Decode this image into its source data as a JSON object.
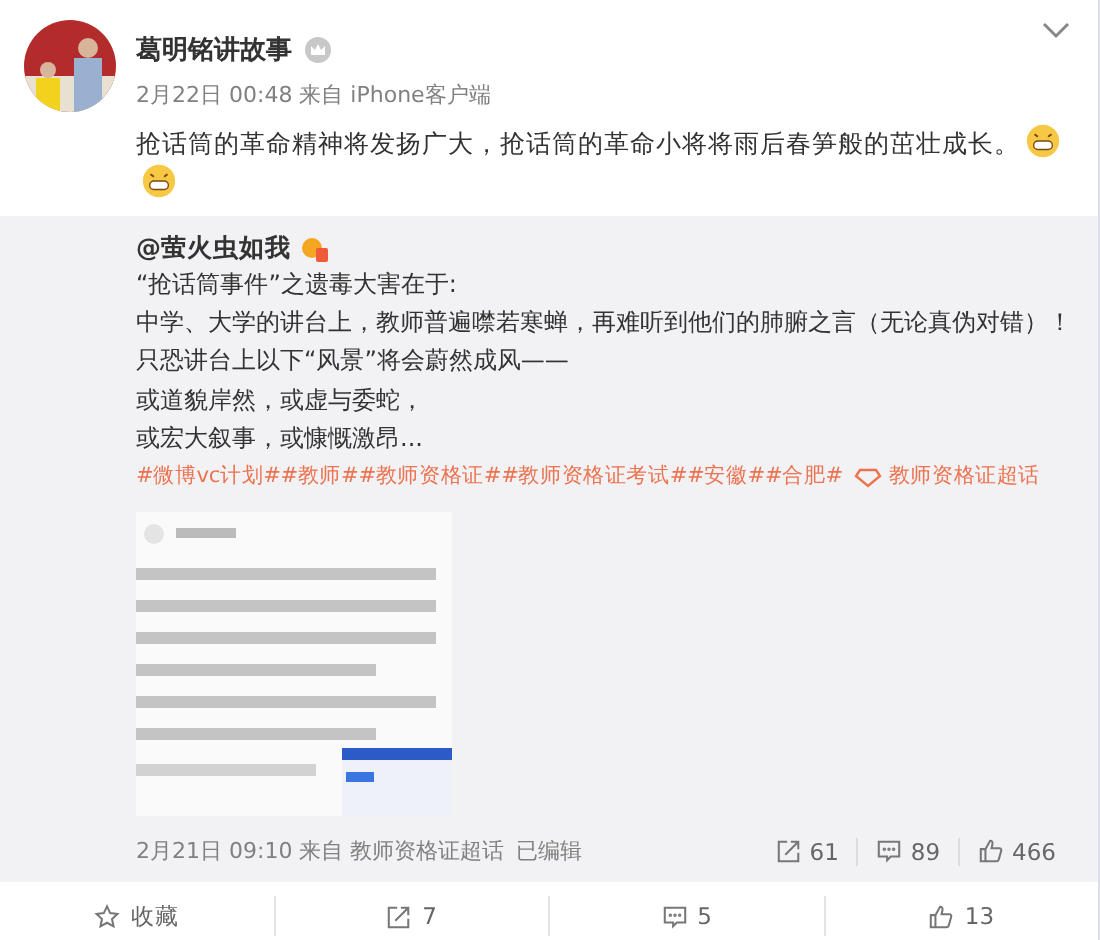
{
  "author": {
    "name": "葛明铭讲故事",
    "meta": "2月22日 00:48 来自 iPhone客户端"
  },
  "body": "抢话筒的革命精神将发扬广大，抢话筒的革命小将将雨后春笋般的茁壮成长。",
  "emojis": [
    {
      "kind": "grin"
    },
    {
      "kind": "grin"
    }
  ],
  "repost": {
    "author": "@萤火虫如我",
    "lines": [
      "“抢话筒事件”之遗毒大害在于:",
      "中学、大学的讲台上，教师普遍噤若寒蝉，再难听到他们的肺腑之言（无论真伪对错）！",
      "只恐讲台上以下“风景”将会蔚然成风——",
      "或道貌岸然，或虚与委蛇，",
      "或宏大叙事，或慷慨激昂..."
    ],
    "topics": [
      "#微博vc计划#",
      "#教师#",
      "#教师资格证#",
      "#教师资格证考试#",
      "#安徽#",
      "#合肥#"
    ],
    "supertopic": "教师资格证超话",
    "image": {
      "kind": "picture"
    },
    "meta": "2月21日 09:10 来自 教师资格证超话",
    "edited": "已编辑",
    "stats": [
      {
        "kind": "share",
        "count": "61"
      },
      {
        "kind": "comment",
        "count": "89"
      },
      {
        "kind": "like",
        "count": "466"
      }
    ]
  },
  "actions": [
    {
      "kind": "favorite",
      "label": "收藏"
    },
    {
      "kind": "share",
      "label": "7"
    },
    {
      "kind": "comment",
      "label": "5"
    },
    {
      "kind": "like",
      "label": "13"
    }
  ]
}
